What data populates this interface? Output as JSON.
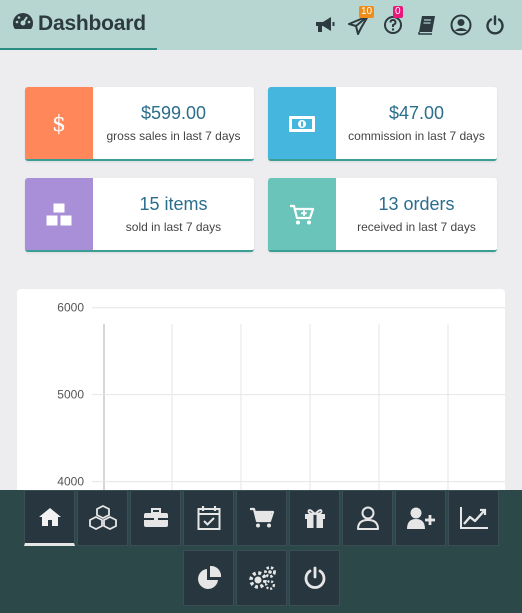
{
  "header": {
    "title": "Dashboard",
    "icons": [
      "dashboard-gauge-icon",
      "megaphone-icon",
      "paper-plane-icon",
      "help-icon",
      "book-icon",
      "user-circle-icon",
      "power-icon"
    ],
    "notifications_badge": "10",
    "help_badge": "0",
    "badge_colors": {
      "notifications": "#f08c1a",
      "help": "#e8177a"
    }
  },
  "stats": [
    {
      "value": "$599.00",
      "label": "gross sales in last 7 days",
      "color": "#ff875a",
      "icon": "dollar-icon"
    },
    {
      "value": "$47.00",
      "label": "commission in last 7 days",
      "color": "#45b6dd",
      "icon": "money-bill-icon"
    },
    {
      "value": "15 items",
      "label": "sold in last 7 days",
      "color": "#a98fd8",
      "icon": "cubes-icon"
    },
    {
      "value": "13 orders",
      "label": "received in last 7 days",
      "color": "#6bc4b9",
      "icon": "cart-plus-icon"
    }
  ],
  "chart_data": {
    "type": "line",
    "title": "",
    "xlabel": "",
    "ylabel": "",
    "ylim": [
      3800,
      6100
    ],
    "yticks": [
      "6000",
      "5000",
      "4000"
    ],
    "grid": true,
    "series": []
  },
  "bottom_nav": [
    {
      "name": "home",
      "icon": "home-icon",
      "active": true
    },
    {
      "name": "products",
      "icon": "cubes-icon",
      "active": false
    },
    {
      "name": "briefcase",
      "icon": "briefcase-icon",
      "active": false
    },
    {
      "name": "calendar",
      "icon": "calendar-check-icon",
      "active": false
    },
    {
      "name": "cart",
      "icon": "cart-icon",
      "active": false
    },
    {
      "name": "gift",
      "icon": "gift-icon",
      "active": false
    },
    {
      "name": "user",
      "icon": "user-icon",
      "active": false
    },
    {
      "name": "user-add",
      "icon": "user-plus-icon",
      "active": false
    },
    {
      "name": "reports",
      "icon": "line-chart-icon",
      "active": false
    },
    {
      "name": "pie",
      "icon": "pie-chart-icon",
      "active": false
    },
    {
      "name": "settings",
      "icon": "gears-icon",
      "active": false
    },
    {
      "name": "logout",
      "icon": "power-icon",
      "active": false
    }
  ]
}
